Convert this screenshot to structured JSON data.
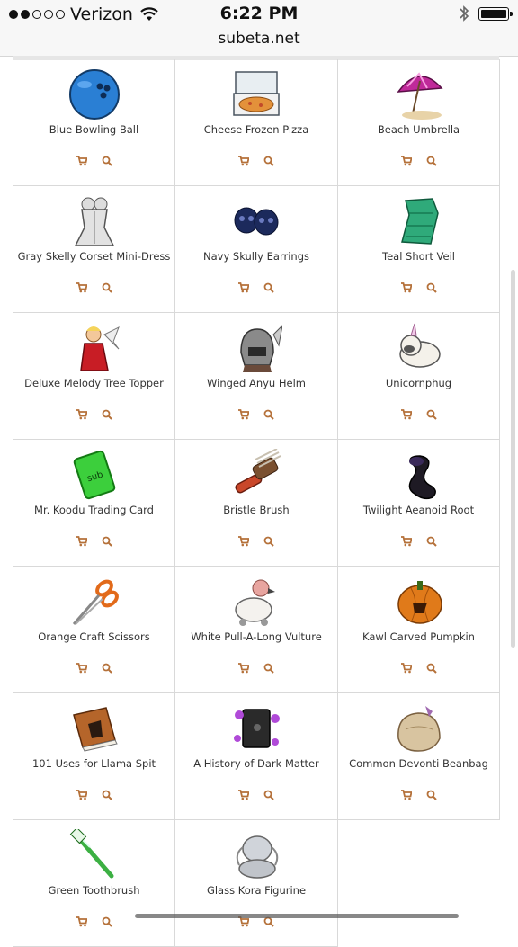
{
  "status_bar": {
    "carrier": "Verizon",
    "time": "6:22 PM"
  },
  "browser": {
    "url": "subeta.net"
  },
  "colors": {
    "action_icon": "#b5713a",
    "grid_line": "#d9d9d9"
  },
  "items": [
    {
      "name": "Blue Bowling Ball",
      "icon": "bowling-ball-icon"
    },
    {
      "name": "Cheese Frozen Pizza",
      "icon": "pizza-box-icon"
    },
    {
      "name": "Beach Umbrella",
      "icon": "umbrella-icon"
    },
    {
      "name": "Gray Skelly Corset Mini-Dress",
      "icon": "dress-icon"
    },
    {
      "name": "Navy Skully Earrings",
      "icon": "skull-earrings-icon"
    },
    {
      "name": "Teal Short Veil",
      "icon": "veil-icon"
    },
    {
      "name": "Deluxe Melody Tree Topper",
      "icon": "angel-topper-icon"
    },
    {
      "name": "Winged Anyu Helm",
      "icon": "helm-icon"
    },
    {
      "name": "Unicornphug",
      "icon": "unicorn-pug-icon"
    },
    {
      "name": "Mr. Koodu Trading Card",
      "icon": "trading-card-icon"
    },
    {
      "name": "Bristle Brush",
      "icon": "brush-icon"
    },
    {
      "name": "Twilight Aeanoid Root",
      "icon": "dark-root-icon"
    },
    {
      "name": "Orange Craft Scissors",
      "icon": "scissors-icon"
    },
    {
      "name": "White Pull-A-Long Vulture",
      "icon": "vulture-toy-icon"
    },
    {
      "name": "Kawl Carved Pumpkin",
      "icon": "pumpkin-icon"
    },
    {
      "name": "101 Uses for Llama Spit",
      "icon": "book-icon"
    },
    {
      "name": "A History of Dark Matter",
      "icon": "dark-book-icon"
    },
    {
      "name": "Common Devonti Beanbag",
      "icon": "beanbag-icon"
    },
    {
      "name": "Green Toothbrush",
      "icon": "toothbrush-icon"
    },
    {
      "name": "Glass Kora Figurine",
      "icon": "figurine-icon"
    }
  ]
}
